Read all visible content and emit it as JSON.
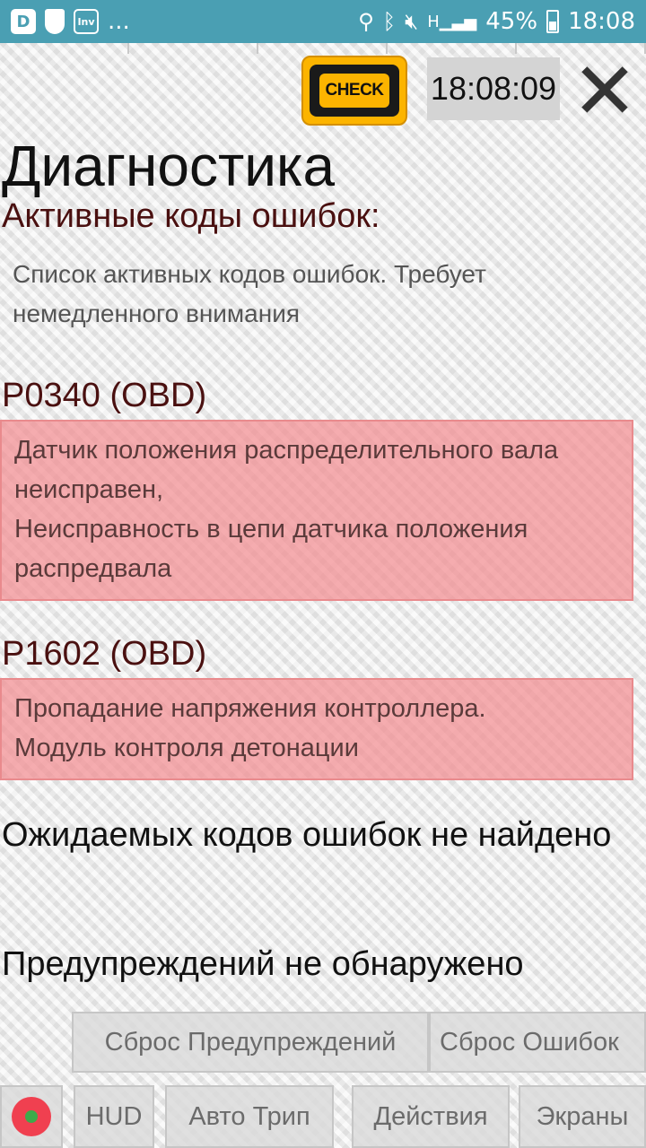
{
  "statusbar": {
    "app_icon_letter": "D",
    "small_icon_text": "Inv",
    "more": "...",
    "signal_letter": "H",
    "battery": "45%",
    "time": "18:08"
  },
  "header": {
    "check_label": "CHECK",
    "clock": "18:08:09",
    "close_glyph": "✕"
  },
  "page": {
    "title": "Диагностика",
    "subtitle": "Активные коды ошибок:",
    "intro": "Список активных кодов ошибок. Требует немедленного внимания"
  },
  "codes": [
    {
      "title": "P0340 (OBD)",
      "lines": [
        "Датчик положения распределительного вала неисправен,",
        "Неисправность в цепи датчика положения распредвала"
      ]
    },
    {
      "title": "P1602 (OBD)",
      "lines": [
        "Пропадание напряжения контроллера.",
        "Модуль контроля детонации"
      ]
    }
  ],
  "messages": {
    "pending": "Ожидаемых кодов ошибок не найдено",
    "warnings": "Предупреждений не обнаружено"
  },
  "buttons": {
    "reset_warnings": "Сброс Предупреждений",
    "reset_errors": "Сброс Ошибок",
    "hud": "HUD",
    "auto_trip": "Авто Трип",
    "actions": "Действия",
    "screens": "Экраны"
  },
  "colors": {
    "statusbar": "#4a9fb3",
    "check_engine": "#fcb400",
    "error_box": "#f28e92",
    "code_title": "#4a1010"
  }
}
